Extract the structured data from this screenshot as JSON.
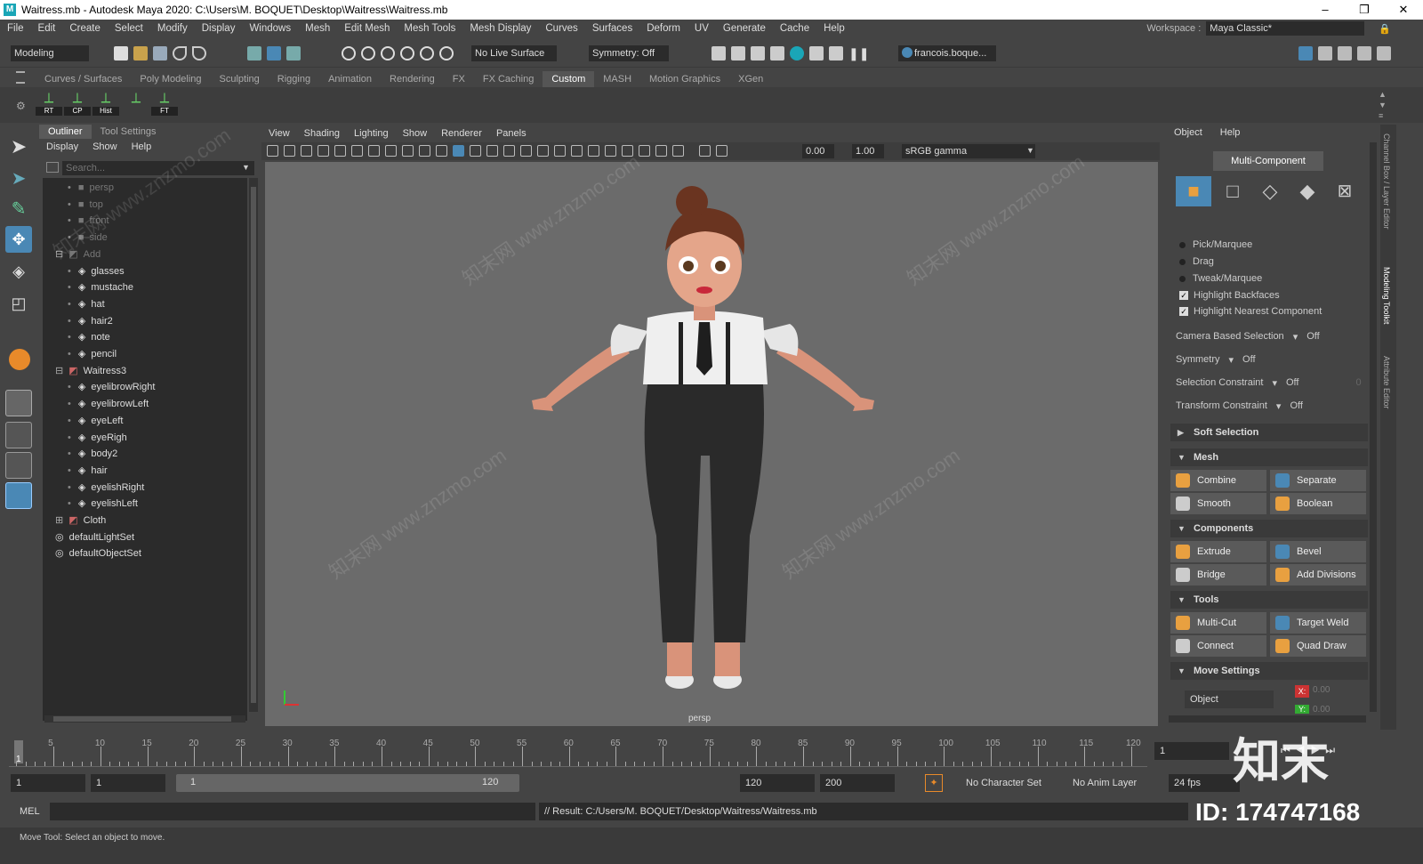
{
  "window": {
    "title": "Waitress.mb - Autodesk Maya 2020: C:\\Users\\M. BOQUET\\Desktop\\Waitress\\Waitress.mb",
    "min": "–",
    "max": "❐",
    "close": "✕"
  },
  "menu": [
    "File",
    "Edit",
    "Create",
    "Select",
    "Modify",
    "Display",
    "Windows",
    "Mesh",
    "Edit Mesh",
    "Mesh Tools",
    "Mesh Display",
    "Curves",
    "Surfaces",
    "Deform",
    "UV",
    "Generate",
    "Cache",
    "Help"
  ],
  "workspace": {
    "label": "Workspace :",
    "value": "Maya Classic*"
  },
  "toolbar": {
    "mode": "Modeling",
    "live_surface": "No Live Surface",
    "symmetry": "Symmetry: Off",
    "user": "francois.boque..."
  },
  "shelf_tabs": [
    "Curves / Surfaces",
    "Poly Modeling",
    "Sculpting",
    "Rigging",
    "Animation",
    "Rendering",
    "FX",
    "FX Caching",
    "Custom",
    "MASH",
    "Motion Graphics",
    "XGen"
  ],
  "shelf_active": "Custom",
  "shelf_buttons": [
    "RT",
    "CP",
    "Hist",
    "",
    "FT"
  ],
  "outliner": {
    "tabs": [
      "Outliner",
      "Tool Settings"
    ],
    "menu": [
      "Display",
      "Show",
      "Help"
    ],
    "search_placeholder": "Search...",
    "items": [
      {
        "label": "persp",
        "level": 1,
        "kind": "camera",
        "dim": true
      },
      {
        "label": "top",
        "level": 1,
        "kind": "camera",
        "dim": true
      },
      {
        "label": "front",
        "level": 1,
        "kind": "camera",
        "dim": true
      },
      {
        "label": "side",
        "level": 1,
        "kind": "camera",
        "dim": true
      },
      {
        "label": "Add",
        "level": 0,
        "kind": "set",
        "dim": true,
        "expand": "−"
      },
      {
        "label": "glasses",
        "level": 1,
        "kind": "mesh"
      },
      {
        "label": "mustache",
        "level": 1,
        "kind": "mesh"
      },
      {
        "label": "hat",
        "level": 1,
        "kind": "mesh"
      },
      {
        "label": "hair2",
        "level": 1,
        "kind": "mesh"
      },
      {
        "label": "note",
        "level": 1,
        "kind": "mesh"
      },
      {
        "label": "pencil",
        "level": 1,
        "kind": "mesh"
      },
      {
        "label": "Waitress3",
        "level": 0,
        "kind": "set",
        "expand": "−"
      },
      {
        "label": "eyelibrowRight",
        "level": 1,
        "kind": "mesh"
      },
      {
        "label": "eyelibrowLeft",
        "level": 1,
        "kind": "mesh"
      },
      {
        "label": "eyeLeft",
        "level": 1,
        "kind": "mesh"
      },
      {
        "label": "eyeRigh",
        "level": 1,
        "kind": "mesh"
      },
      {
        "label": "body2",
        "level": 1,
        "kind": "mesh"
      },
      {
        "label": "hair",
        "level": 1,
        "kind": "mesh"
      },
      {
        "label": "eyelishRight",
        "level": 1,
        "kind": "mesh"
      },
      {
        "label": "eyelishLeft",
        "level": 1,
        "kind": "mesh"
      },
      {
        "label": "Cloth",
        "level": 0,
        "kind": "set",
        "expand": "+"
      },
      {
        "label": "defaultLightSet",
        "level": 0,
        "kind": "lightset"
      },
      {
        "label": "defaultObjectSet",
        "level": 0,
        "kind": "lightset"
      }
    ]
  },
  "viewport": {
    "menu": [
      "View",
      "Shading",
      "Lighting",
      "Show",
      "Renderer",
      "Panels"
    ],
    "exposure": "0.00",
    "gamma": "1.00",
    "colorspace": "sRGB gamma",
    "camera_label": "persp"
  },
  "modeling_toolkit": {
    "menu": [
      "Object",
      "Help"
    ],
    "mode_button": "Multi-Component",
    "radios": [
      "Pick/Marquee",
      "Drag",
      "Tweak/Marquee"
    ],
    "checks": [
      "Highlight Backfaces",
      "Highlight Nearest Component"
    ],
    "props": [
      {
        "label": "Camera Based Selection",
        "value": "Off"
      },
      {
        "label": "Symmetry",
        "value": "Off"
      },
      {
        "label": "Selection Constraint",
        "value": "Off",
        "extra": "0"
      },
      {
        "label": "Transform Constraint",
        "value": "Off"
      }
    ],
    "soft_selection": "Soft Selection",
    "sections": [
      {
        "title": "Mesh",
        "buttons": [
          "Combine",
          "Separate",
          "Smooth",
          "Boolean"
        ]
      },
      {
        "title": "Components",
        "buttons": [
          "Extrude",
          "Bevel",
          "Bridge",
          "Add Divisions"
        ]
      },
      {
        "title": "Tools",
        "buttons": [
          "Multi-Cut",
          "Target Weld",
          "Connect",
          "Quad Draw"
        ]
      }
    ],
    "move_settings": "Move Settings",
    "move_object": "Object",
    "axis_x": "X:",
    "axis_y": "Y:",
    "axis_val": "0.00"
  },
  "side_tabs": [
    "Channel Box / Layer Editor",
    "Modeling Toolkit",
    "Attribute Editor"
  ],
  "timeline": {
    "ticks": [
      5,
      10,
      15,
      20,
      25,
      30,
      35,
      40,
      45,
      50,
      55,
      60,
      65,
      70,
      75,
      80,
      85,
      90,
      95,
      100,
      105,
      110,
      115,
      120
    ],
    "current_frame": "1",
    "frame_field": "1"
  },
  "range": {
    "start": "1",
    "start2": "1",
    "slider_start": "1",
    "slider_end": "120",
    "end": "120",
    "end2": "200",
    "char_set": "No Character Set",
    "anim_layer": "No Anim Layer",
    "fps": "24 fps"
  },
  "command": {
    "lang": "MEL",
    "result": "// Result: C:/Users/M. BOQUET/Desktop/Waitress/Waitress.mb"
  },
  "help_line": "Move Tool: Select an object to move.",
  "watermark": {
    "id": "ID: 174747168",
    "brand": "知末",
    "text": "知末网 www.znzmo.com"
  },
  "colors": {
    "accent": "#1aa6b7",
    "active_tool": "#4a88b5",
    "mesh_icon": "#d8882a"
  }
}
